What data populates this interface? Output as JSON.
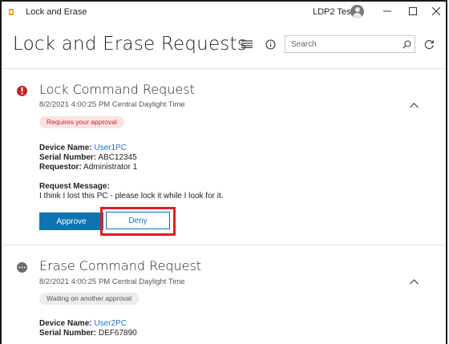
{
  "window": {
    "app_title": "Lock and Erase",
    "user_name": "LDP2 Test"
  },
  "header": {
    "page_title": "Lock and Erase Requests",
    "search_placeholder": "Search"
  },
  "requests": [
    {
      "title": "Lock Command Request",
      "date": "8/2/2021 4:00:25 PM Central Daylight Time",
      "status_badge": "Requires your approval",
      "status_icon": "error-icon",
      "device_name_label": "Device Name:",
      "device_name": "User1PC",
      "serial_label": "Serial Number:",
      "serial": "ABC12345",
      "requestor_label": "Requestor:",
      "requestor": "Administrator 1",
      "message_label": "Request Message:",
      "message": "I think I lost this PC - please lock it while I look for it.",
      "approve_label": "Approve",
      "deny_label": "Deny"
    },
    {
      "title": "Erase Command Request",
      "date": "8/2/2021 4:00:25 PM Central Daylight Time",
      "status_badge": "Waiting on another approval",
      "status_icon": "pending-icon",
      "device_name_label": "Device Name:",
      "device_name": "User2PC",
      "serial_label": "Serial Number:",
      "serial": "DEF67890"
    }
  ],
  "colors": {
    "accent": "#0f73b2",
    "error": "#c4262e",
    "highlight": "#e01e26",
    "link": "#1a73c5"
  }
}
